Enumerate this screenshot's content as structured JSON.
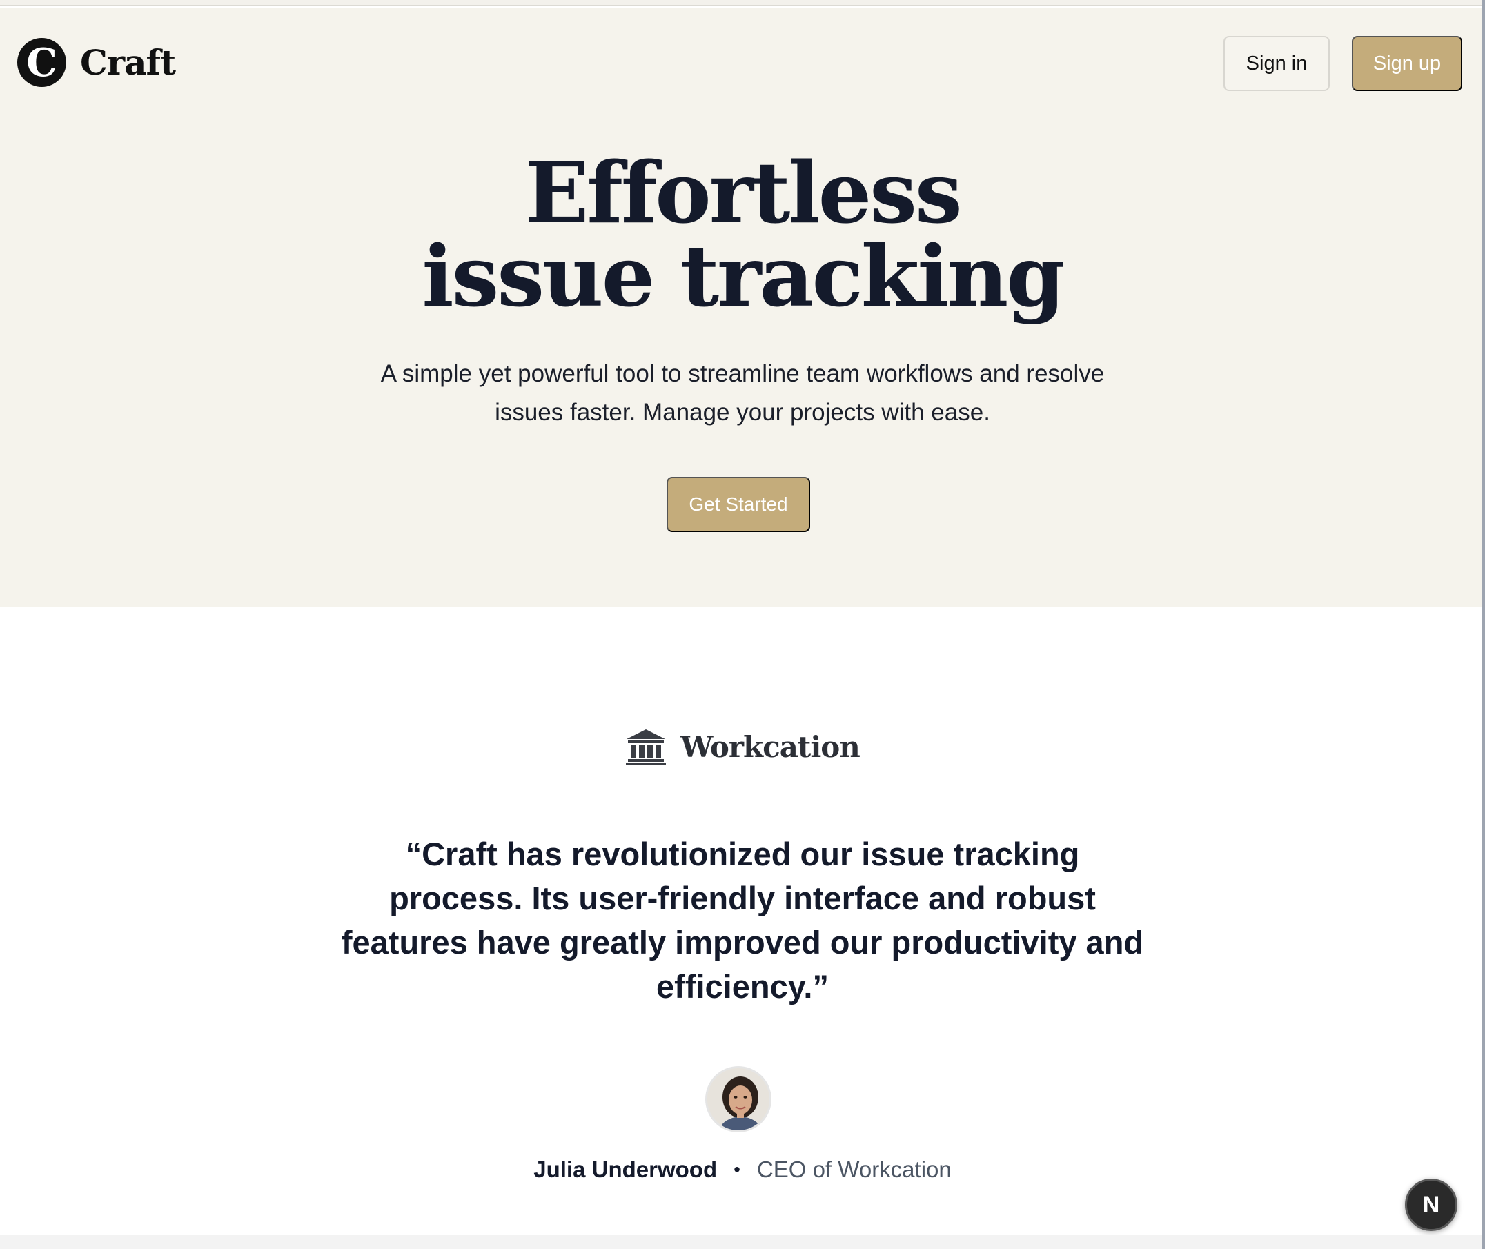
{
  "brand": {
    "logo_letter": "C",
    "name": "Craft",
    "accent_color": "#c4ac7b",
    "hero_background": "#f5f3ec",
    "text_color": "#141a2b"
  },
  "nav": {
    "signin_label": "Sign in",
    "signup_label": "Sign up"
  },
  "hero": {
    "title_line1": "Effortless",
    "title_line2": "issue tracking",
    "subtitle_line1": "A simple yet powerful tool to streamline team workflows and resolve",
    "subtitle_line2": "issues faster. Manage your projects with ease.",
    "cta_label": "Get Started"
  },
  "testimonial": {
    "company_icon": "bank-building-icon",
    "company_name": "Workcation",
    "quote_line1": "“Craft has revolutionized our issue tracking",
    "quote_line2": "process. Its user-friendly interface and robust",
    "quote_line3": "features have greatly improved our productivity and",
    "quote_line4": "efficiency.”",
    "author_name": "Julia Underwood",
    "separator": "•",
    "author_role": "CEO of Workcation"
  },
  "badge": {
    "letter": "N",
    "icon": "nextjs-logo-icon"
  }
}
